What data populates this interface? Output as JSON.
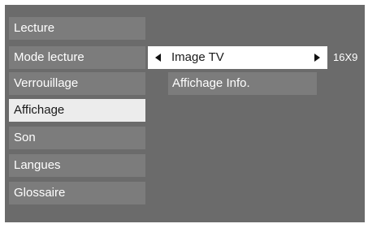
{
  "menu": {
    "items": [
      {
        "label": "Lecture"
      },
      {
        "label": "Mode lecture"
      },
      {
        "label": "Verrouillage"
      },
      {
        "label": "Affichage",
        "selected": true
      },
      {
        "label": "Son"
      },
      {
        "label": "Langues"
      },
      {
        "label": "Glossaire"
      }
    ]
  },
  "submenu": {
    "image_tv": {
      "label": "Image TV",
      "value": "16X9"
    },
    "affichage_info": {
      "label": "Affichage Info."
    }
  },
  "colors": {
    "panel": "#6b6b6b",
    "item": "#7c7c7c",
    "selected": "#ececec",
    "highlight_row": "#ffffff"
  }
}
